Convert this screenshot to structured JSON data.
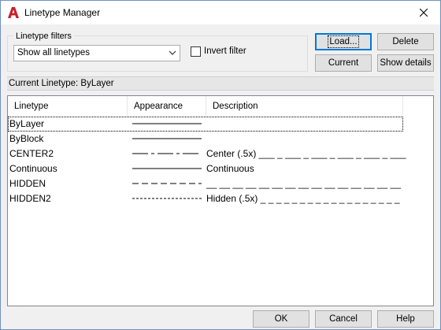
{
  "window": {
    "title": "Linetype Manager",
    "brand_color": "#c8202b"
  },
  "filters": {
    "group_label": "Linetype filters",
    "selected": "Show all linetypes",
    "invert_label": "Invert filter",
    "invert_checked": false
  },
  "buttons": {
    "load": "Load...",
    "delete": "Delete",
    "current": "Current",
    "show_details": "Show details",
    "ok": "OK",
    "cancel": "Cancel",
    "help": "Help"
  },
  "current_linetype": {
    "label": "Current Linetype:",
    "value": "ByLayer"
  },
  "list": {
    "columns": [
      "Linetype",
      "Appearance",
      "Description"
    ],
    "rows": [
      {
        "name": "ByLayer",
        "pattern": "solid",
        "description": "",
        "selected": true
      },
      {
        "name": "ByBlock",
        "pattern": "solid",
        "description": "",
        "selected": false
      },
      {
        "name": "CENTER2",
        "pattern": "center",
        "description": "Center (.5x) ___ _ ___ _ ___ _ ___ _ ___ _ ___",
        "selected": false
      },
      {
        "name": "Continuous",
        "pattern": "solid",
        "description": "Continuous",
        "selected": false
      },
      {
        "name": "HIDDEN",
        "pattern": "hidden",
        "description": "__ __ __ __ __ __ __ __ __ __ __ __ __ __ __",
        "selected": false
      },
      {
        "name": "HIDDEN2",
        "pattern": "hidden2",
        "description": "Hidden (.5x) _ _ _ _ _ _ _ _ _ _ _ _ _ _ _ _ _ _",
        "selected": false
      }
    ]
  }
}
